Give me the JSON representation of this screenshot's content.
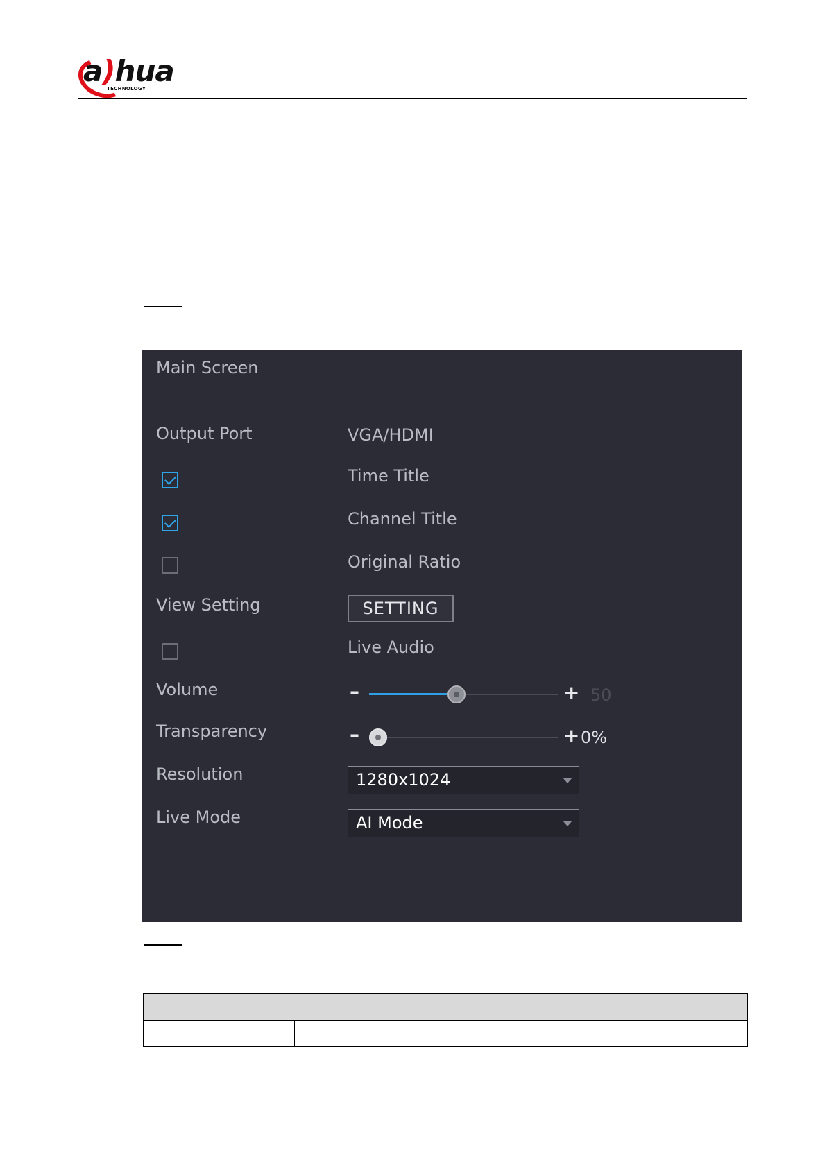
{
  "header": {
    "logo": {
      "wordmark": "a)hua",
      "tagline": "TECHNOLOGY",
      "accent_color": "#e0101b"
    }
  },
  "panel": {
    "title": "Main Screen",
    "output_port": {
      "label": "Output Port",
      "value": "VGA/HDMI"
    },
    "time_title": {
      "label": "Time Title",
      "checked": true
    },
    "channel_title": {
      "label": "Channel Title",
      "checked": true
    },
    "original_ratio": {
      "label": "Original Ratio",
      "checked": false
    },
    "view_setting": {
      "label": "View Setting",
      "button_label": "SETTING"
    },
    "live_audio": {
      "label": "Live Audio",
      "checked": false
    },
    "volume": {
      "label": "Volume",
      "value": "50",
      "level": 0.5
    },
    "transparency": {
      "label": "Transparency",
      "value": "0%",
      "level": 0.0
    },
    "resolution": {
      "label": "Resolution",
      "value": "1280x1024"
    },
    "live_mode": {
      "label": "Live Mode",
      "value": "AI Mode"
    },
    "colors": {
      "background": "#2b2c35",
      "accent": "#2fa4e7"
    }
  }
}
